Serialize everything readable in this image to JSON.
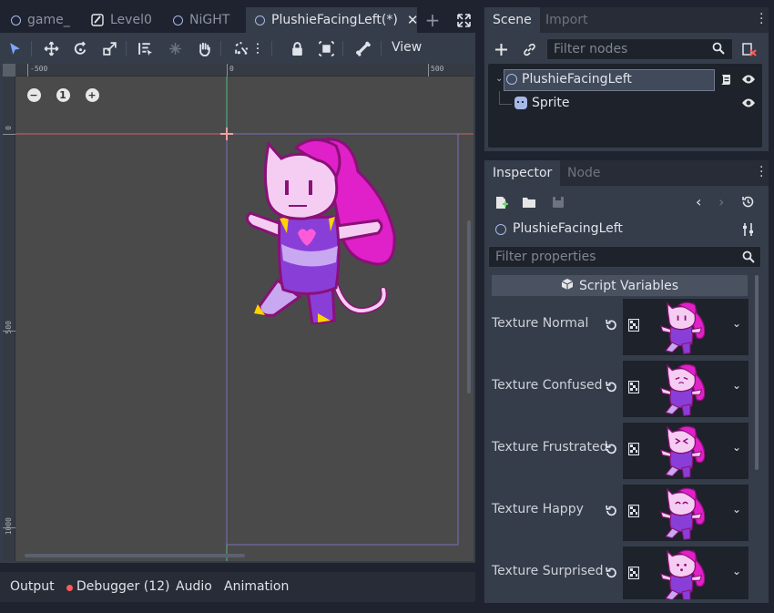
{
  "tabs": [
    {
      "label": "game_",
      "icon": "ring-icon"
    },
    {
      "label": "Level0",
      "icon": "pencil-icon"
    },
    {
      "label": "NiGHT",
      "icon": "ring-icon"
    },
    {
      "label": "PlushieFacingLeft(*)",
      "icon": "ring-icon",
      "active": true
    }
  ],
  "toolbar": {
    "view_label": "View"
  },
  "ruler": {
    "top_labels": [
      "-500",
      "0",
      "500"
    ],
    "left_labels": [
      "0",
      "500",
      "1000"
    ]
  },
  "zoom": {
    "reset_label": "1"
  },
  "bottom_tabs": {
    "output": "Output",
    "debugger": "Debugger (12)",
    "audio": "Audio",
    "animation": "Animation"
  },
  "scene": {
    "tab_scene": "Scene",
    "tab_import": "Import",
    "filter_placeholder": "Filter nodes",
    "nodes": [
      {
        "label": "PlushieFacingLeft",
        "icon": "node2d-icon"
      },
      {
        "label": "Sprite",
        "icon": "sprite-icon"
      }
    ]
  },
  "inspector": {
    "tab_inspector": "Inspector",
    "tab_node": "Node",
    "object_name": "PlushieFacingLeft",
    "filter_placeholder": "Filter properties",
    "section_title": "Script Variables",
    "properties": [
      {
        "label": "Texture Normal",
        "face": "normal"
      },
      {
        "label": "Texture Confused",
        "face": "confused"
      },
      {
        "label": "Texture Frustrated",
        "face": "frustrated"
      },
      {
        "label": "Texture Happy",
        "face": "happy"
      },
      {
        "label": "Texture Surprised",
        "face": "surprised"
      }
    ]
  },
  "colors": {
    "accent": "#a6b8e8",
    "plushie_magenta": "#e020c8",
    "plushie_purple": "#8a3ed8",
    "error_dot": "#ff5a5a",
    "guide_red": "#c86464",
    "guide_green": "#5ab48c"
  }
}
